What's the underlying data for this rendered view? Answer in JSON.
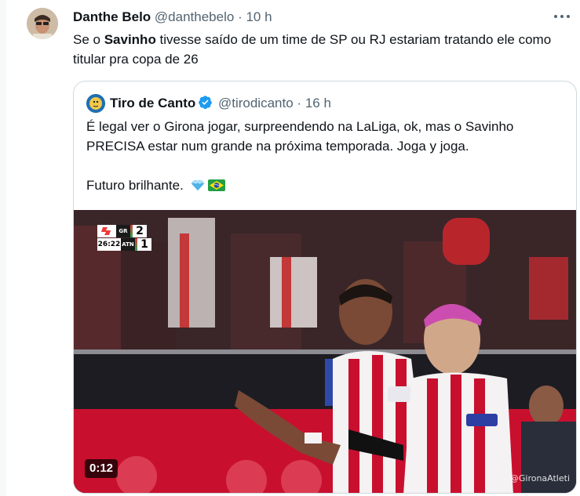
{
  "tweet": {
    "author_name": "Danthe Belo",
    "author_handle": "@danthebelo",
    "separator": "·",
    "time": "10 h",
    "text_before": "Se o ",
    "text_bold": "Savinho",
    "text_after": " tivesse saído de um time de SP ou RJ estariam tratando ele como titular pra copa de 26"
  },
  "quote": {
    "author_name": "Tiro de Canto",
    "author_handle": "@tirodicanto",
    "separator": "·",
    "time": "16 h",
    "text_line1": "É legal ver o Girona jogar, surpreendendo na LaLiga, ok, mas o Savinho PRECISA estar num grande na próxima temporada. Joga y joga.",
    "text_line2": "Futuro brilhante.",
    "emojis": [
      "diamond-emoji",
      "brazil-flag-emoji"
    ]
  },
  "video": {
    "scoreboard": {
      "home_team": "GR",
      "away_team": "ATN",
      "home_score": "2",
      "away_score": "1",
      "clock": "26:22"
    },
    "duration": "0:12",
    "watermark": "@GironaAtleti"
  },
  "colors": {
    "text": "#0f1419",
    "muted": "#536471",
    "verified": "#1d9bf0",
    "border": "#cfd9de"
  }
}
